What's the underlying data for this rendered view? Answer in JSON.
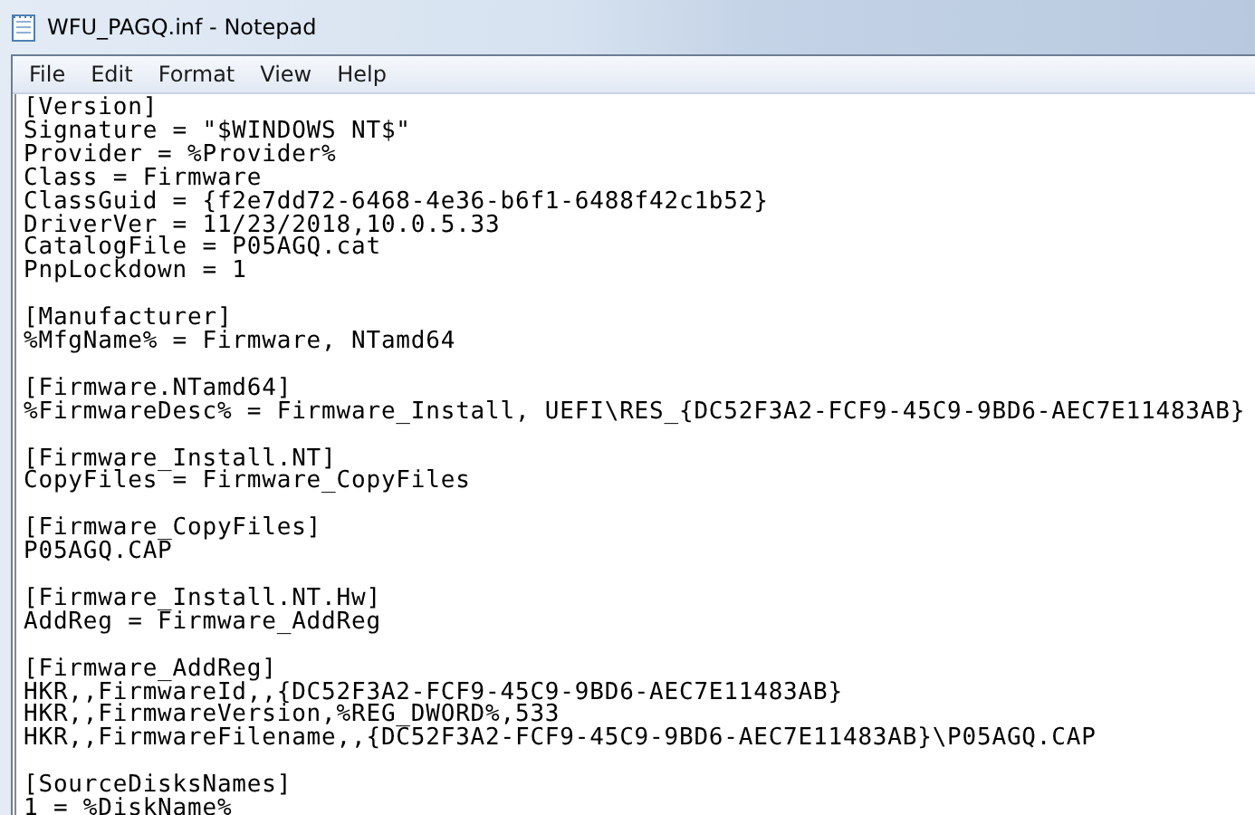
{
  "window": {
    "title": "WFU_PAGQ.inf - Notepad"
  },
  "menu": [
    "File",
    "Edit",
    "Format",
    "View",
    "Help"
  ],
  "sections": [
    [
      "[Version]",
      "Signature = \"$WINDOWS NT$\"",
      "Provider = %Provider%",
      "Class = Firmware",
      "ClassGuid = {f2e7dd72-6468-4e36-b6f1-6488f42c1b52}",
      "DriverVer = 11/23/2018,10.0.5.33",
      "CatalogFile = P05AGQ.cat",
      "PnpLockdown = 1"
    ],
    [
      "[Manufacturer]",
      "%MfgName% = Firmware, NTamd64"
    ],
    [
      "[Firmware.NTamd64]",
      "%FirmwareDesc% = Firmware_Install, UEFI\\RES_{DC52F3A2-FCF9-45C9-9BD6-AEC7E11483AB}"
    ],
    [
      "[Firmware_Install.NT]",
      "CopyFiles = Firmware_CopyFiles"
    ],
    [
      "[Firmware_CopyFiles]",
      "P05AGQ.CAP"
    ],
    [
      "[Firmware_Install.NT.Hw]",
      "AddReg = Firmware_AddReg"
    ],
    [
      "[Firmware_AddReg]",
      "HKR,,FirmwareId,,{DC52F3A2-FCF9-45C9-9BD6-AEC7E11483AB}",
      "HKR,,FirmwareVersion,%REG_DWORD%,533",
      "HKR,,FirmwareFilename,,{DC52F3A2-FCF9-45C9-9BD6-AEC7E11483AB}\\P05AGQ.CAP"
    ],
    [
      "[SourceDisksNames]",
      "1 = %DiskName%"
    ]
  ]
}
